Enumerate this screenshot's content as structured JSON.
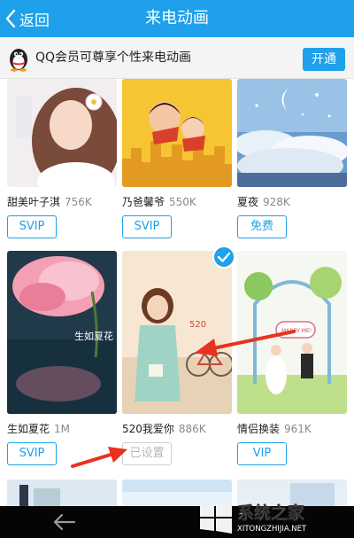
{
  "header": {
    "back_label": "返回",
    "title": "来电动画"
  },
  "promo": {
    "text": "QQ会员可尊享个性来电动画",
    "button_label": "开通"
  },
  "cards": [
    {
      "name": "甜美叶子淇",
      "size": "756K",
      "tag": "SVIP"
    },
    {
      "name": "乃爸馨爷",
      "size": "550K",
      "tag": "SVIP"
    },
    {
      "name": "夏夜",
      "size": "928K",
      "tag": "免费"
    },
    {
      "name": "生如夏花",
      "size": "1M",
      "tag": "SVIP"
    },
    {
      "name": "520我爱你",
      "size": "886K",
      "tag": "已设置"
    },
    {
      "name": "情侣换装",
      "size": "961K",
      "tag": "VIP"
    }
  ],
  "thumb_texts": {
    "xiaru": "生如夏花",
    "num520": "520",
    "marry": "MARRY ME!"
  },
  "watermark": {
    "brand": "系统之家",
    "url": "XITONGZHIJIA.NET"
  },
  "colors": {
    "accent": "#1ea0ea",
    "disabled": "#b8b8b8"
  }
}
